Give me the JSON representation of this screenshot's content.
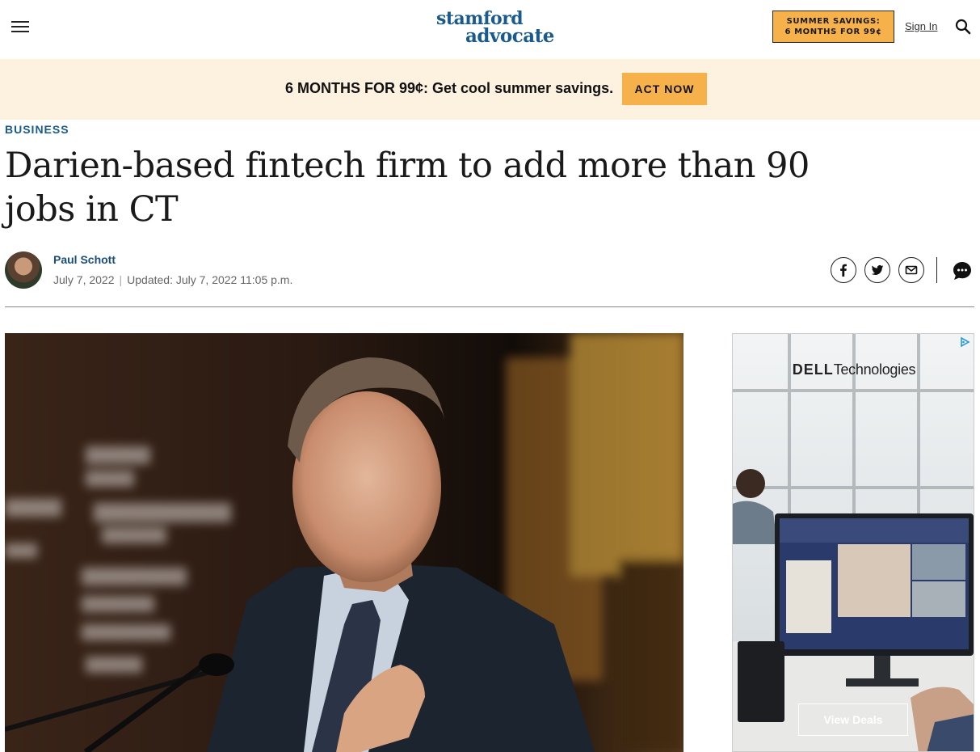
{
  "header": {
    "logo_line1": "stamford",
    "logo_line2": "advocate",
    "promo_line1": "SUMMER SAVINGS:",
    "promo_line2": "6 MONTHS FOR 99¢",
    "signin_label": "Sign In"
  },
  "banner": {
    "text": "6 MONTHS FOR 99¢: Get cool summer savings.",
    "cta_label": "ACT NOW"
  },
  "article": {
    "section": "BUSINESS",
    "headline": "Darien-based fintech firm to add more than 90 jobs in CT",
    "author": "Paul Schott",
    "date_published": "July 7, 2022",
    "date_separator": "|",
    "date_updated": "Updated: July 7, 2022 11:05 p.m."
  },
  "ad": {
    "brand_bold": "DELL",
    "brand_rest": "Technologies",
    "cta_label": "View Deals"
  },
  "colors": {
    "brand_blue": "#1a5a8c",
    "promo_orange": "#f6b14a",
    "banner_bg": "#fdf1e0"
  },
  "icons": [
    "menu-icon",
    "search-icon",
    "facebook-icon",
    "twitter-icon",
    "email-icon",
    "comment-icon",
    "ad-choices-icon"
  ]
}
